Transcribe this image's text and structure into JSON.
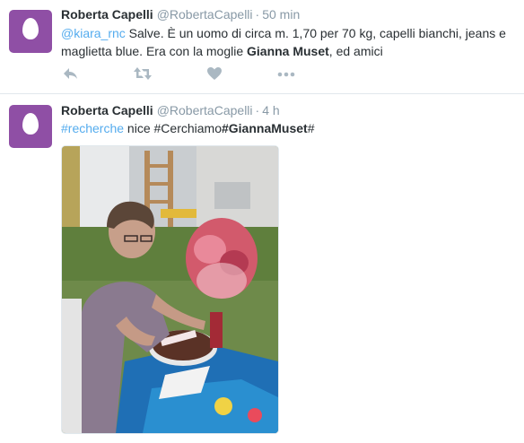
{
  "tweets": [
    {
      "name": "Roberta Capelli",
      "handle": "@RobertaCapelli",
      "separator": "·",
      "time": "50 min",
      "mention": "@kiara_rnc",
      "text_part1": " Salve. È un uomo di circa m. 1,70 per 70 kg, capelli bianchi, jeans e maglietta blue. Era con la moglie ",
      "bold_name": "Gianna Muset",
      "text_part2": ", ed amici",
      "actions": [
        "reply-icon",
        "retweet-icon",
        "like-icon",
        "more-icon"
      ]
    },
    {
      "name": "Roberta Capelli",
      "handle": "@RobertaCapelli",
      "separator": "·",
      "time": "4 h",
      "hashtag_link": "#recherche",
      "text_mid": " nice #Cerchiamo",
      "hashtag_bold": "#GiannaMuset",
      "text_end": "#",
      "photo_icon": "photo-woman-cake"
    }
  ],
  "colors": {
    "avatar": "#8f4fa5",
    "link": "#55acee",
    "muted": "#8899a6",
    "text": "#292f33",
    "divider": "#e1e8ed"
  }
}
